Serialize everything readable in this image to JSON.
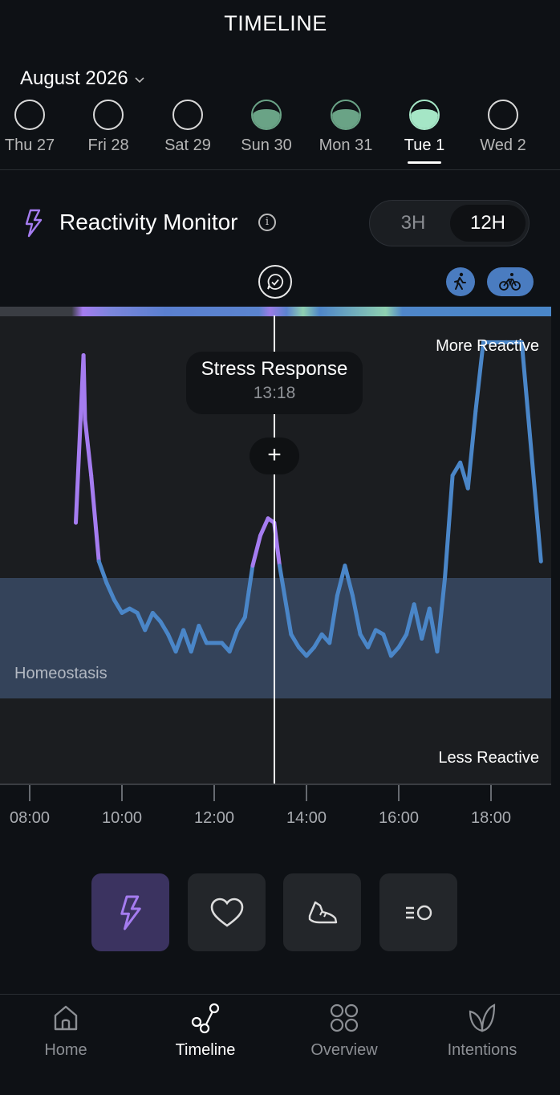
{
  "header": {
    "title": "TIMELINE"
  },
  "month": {
    "label": "August 2026"
  },
  "days": [
    {
      "label": "Thu 27",
      "fill": 0,
      "active": false
    },
    {
      "label": "Fri 28",
      "fill": 0,
      "active": false
    },
    {
      "label": "Sat 29",
      "fill": 0,
      "active": false
    },
    {
      "label": "Sun 30",
      "fill": 0.7,
      "active": false
    },
    {
      "label": "Mon 31",
      "fill": 0.7,
      "active": false
    },
    {
      "label": "Tue 1",
      "fill": 0.7,
      "active": true
    },
    {
      "label": "Wed 2",
      "fill": 0,
      "active": false
    }
  ],
  "monitor": {
    "title": "Reactivity Monitor",
    "toggle": {
      "option_3h": "3H",
      "option_12h": "12H",
      "selected": "12H"
    }
  },
  "chart": {
    "more_reactive": "More Reactive",
    "less_reactive": "Less Reactive",
    "homeostasis": "Homeostasis",
    "tooltip": {
      "title": "Stress Response",
      "time": "13:18"
    },
    "plus_label": "+"
  },
  "metric_buttons": [
    "reactivity",
    "heart",
    "sneaker",
    "speed"
  ],
  "nav": [
    {
      "label": "Home",
      "active": false
    },
    {
      "label": "Timeline",
      "active": true
    },
    {
      "label": "Overview",
      "active": false
    },
    {
      "label": "Intentions",
      "active": false
    }
  ],
  "colors": {
    "accent_purple": "#a57cf0",
    "line_blue": "#4a86c8",
    "moon_green": "#6aa386",
    "moon_active": "#a5e6c6"
  },
  "chart_data": {
    "type": "line",
    "x_label_ticks": [
      "08:00",
      "10:00",
      "12:00",
      "14:00",
      "16:00",
      "18:00"
    ],
    "xlim": [
      "07:30",
      "19:20"
    ],
    "ylim": [
      0,
      100
    ],
    "homeostasis_band": [
      27,
      48
    ],
    "series": [
      {
        "points": [
          [
            "09:00",
            54
          ],
          [
            "09:10",
            93
          ],
          [
            "09:12",
            78
          ],
          [
            "09:20",
            65
          ],
          [
            "09:30",
            45
          ],
          [
            "09:40",
            40
          ],
          [
            "09:50",
            36
          ],
          [
            "10:00",
            33
          ],
          [
            "10:10",
            34
          ],
          [
            "10:20",
            33
          ],
          [
            "10:30",
            29
          ],
          [
            "10:40",
            33
          ],
          [
            "10:50",
            31
          ],
          [
            "11:00",
            28
          ],
          [
            "11:10",
            24
          ],
          [
            "11:20",
            29
          ],
          [
            "11:30",
            24
          ],
          [
            "11:40",
            30
          ],
          [
            "11:50",
            26
          ],
          [
            "12:10",
            26
          ],
          [
            "12:20",
            24
          ],
          [
            "12:30",
            29
          ],
          [
            "12:40",
            32
          ],
          [
            "12:45",
            38
          ],
          [
            "12:50",
            44
          ],
          [
            "13:00",
            51
          ],
          [
            "13:10",
            55
          ],
          [
            "13:18",
            54
          ],
          [
            "13:25",
            44
          ],
          [
            "13:40",
            28
          ],
          [
            "13:50",
            25
          ],
          [
            "14:00",
            23
          ],
          [
            "14:10",
            25
          ],
          [
            "14:20",
            28
          ],
          [
            "14:30",
            26
          ],
          [
            "14:40",
            37
          ],
          [
            "14:50",
            44
          ],
          [
            "15:00",
            37
          ],
          [
            "15:10",
            28
          ],
          [
            "15:20",
            25
          ],
          [
            "15:30",
            29
          ],
          [
            "15:40",
            28
          ],
          [
            "15:50",
            23
          ],
          [
            "16:00",
            25
          ],
          [
            "16:10",
            28
          ],
          [
            "16:20",
            35
          ],
          [
            "16:30",
            27
          ],
          [
            "16:40",
            34
          ],
          [
            "16:50",
            24
          ],
          [
            "17:00",
            41
          ],
          [
            "17:10",
            65
          ],
          [
            "17:20",
            68
          ],
          [
            "17:30",
            62
          ],
          [
            "17:40",
            80
          ],
          [
            "17:50",
            96
          ],
          [
            "18:20",
            96
          ],
          [
            "18:40",
            96
          ],
          [
            "19:05",
            45
          ]
        ]
      }
    ]
  }
}
